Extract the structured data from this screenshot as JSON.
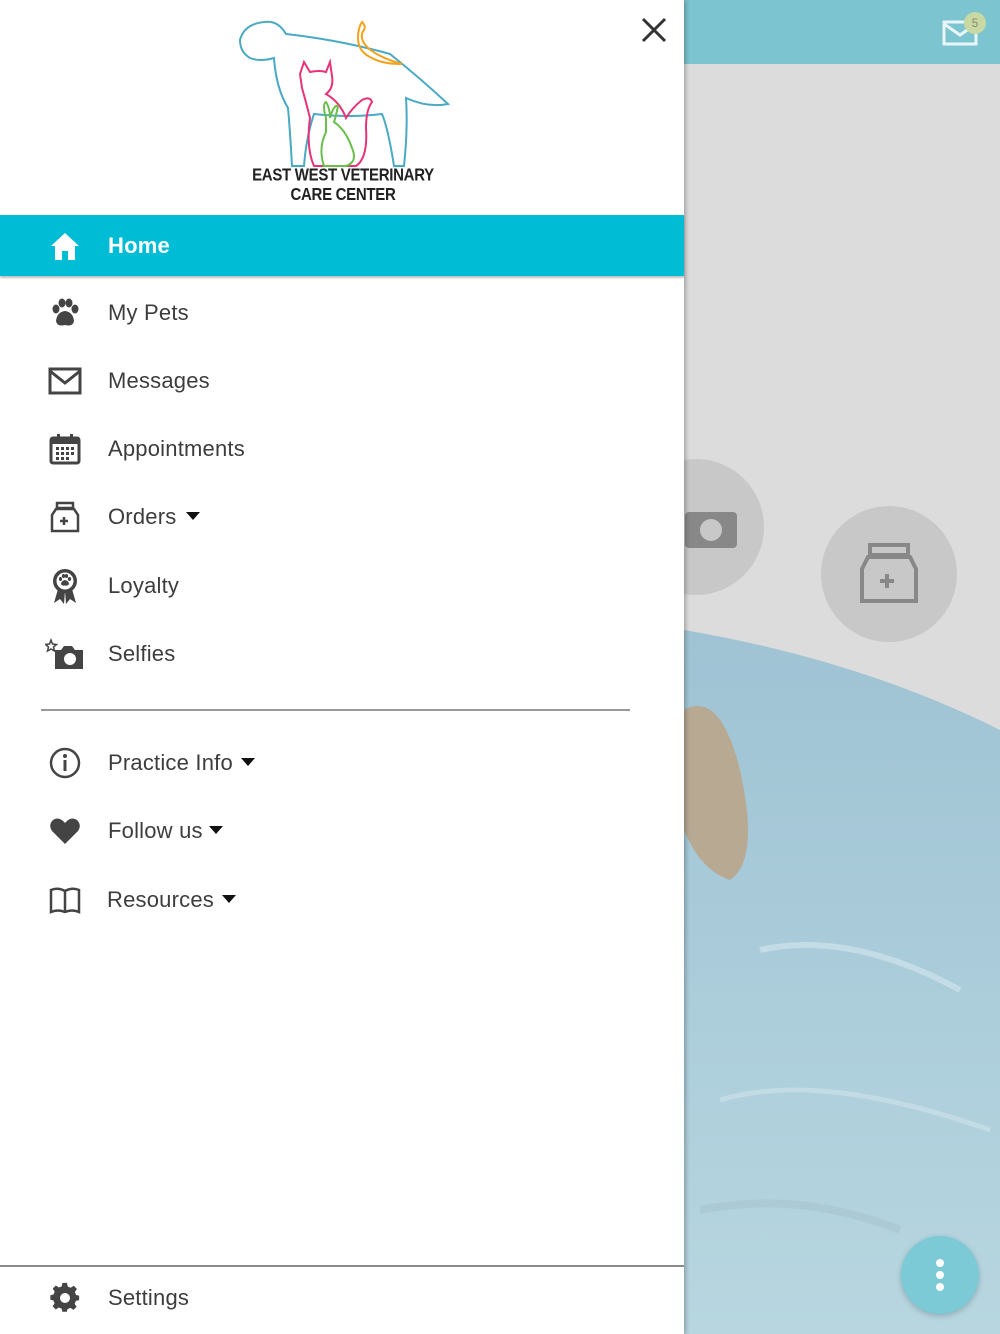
{
  "colors": {
    "accent": "#00bcd4",
    "topbar": "#7cc4d0",
    "icon": "#444444",
    "text": "#3d3d3d"
  },
  "logo": {
    "text": "EAST WEST VETERINARY CARE CENTER"
  },
  "background": {
    "mail_badge": "5"
  },
  "menu": {
    "items": [
      {
        "label": "Home",
        "icon": "home-icon",
        "active": true
      },
      {
        "label": "My Pets",
        "icon": "paw-icon"
      },
      {
        "label": "Messages",
        "icon": "envelope-icon"
      },
      {
        "label": "Appointments",
        "icon": "calendar-icon"
      },
      {
        "label": "Orders",
        "icon": "medicine-bag-icon",
        "has_dropdown": true
      },
      {
        "label": "Loyalty",
        "icon": "award-ribbon-icon"
      },
      {
        "label": "Selfies",
        "icon": "camera-sparkle-icon"
      }
    ],
    "secondary": [
      {
        "label": "Practice Info",
        "icon": "info-icon",
        "has_dropdown": true
      },
      {
        "label": "Follow us",
        "icon": "heart-icon",
        "has_dropdown": true
      },
      {
        "label": "Resources",
        "icon": "book-icon",
        "has_dropdown": true
      }
    ],
    "settings": {
      "label": "Settings",
      "icon": "gear-icon"
    }
  }
}
